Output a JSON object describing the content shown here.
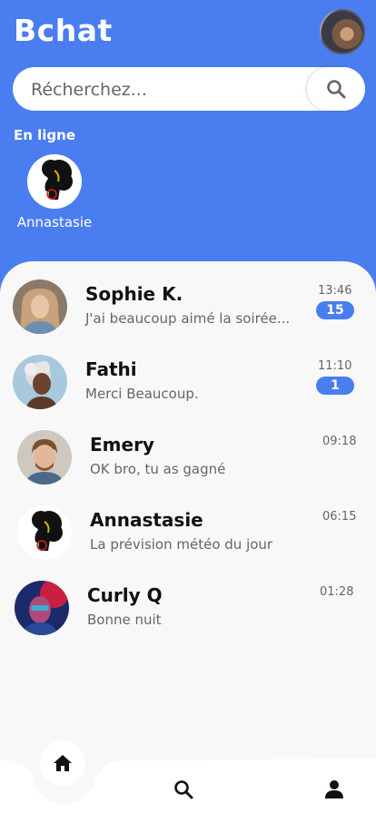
{
  "header": {
    "title": "Bchat"
  },
  "search": {
    "placeholder": "Récherchez..."
  },
  "online": {
    "title": "En ligne",
    "users": [
      {
        "name": "Annastasie"
      }
    ]
  },
  "chats": [
    {
      "name": "Sophie K.",
      "message": "J'ai beaucoup aimé la soirée...",
      "time": "13:46",
      "unread": "15"
    },
    {
      "name": "Fathi",
      "message": "Merci Beaucoup.",
      "time": "11:10",
      "unread": "1"
    },
    {
      "name": "Emery",
      "message": "OK bro, tu as gagné",
      "time": "09:18",
      "unread": ""
    },
    {
      "name": "Annastasie",
      "message": "La prévision météo du jour",
      "time": "06:15",
      "unread": ""
    },
    {
      "name": "Curly Q",
      "message": "Bonne nuit",
      "time": "01:28",
      "unread": ""
    }
  ],
  "nav": {
    "items": [
      {
        "icon": "home-icon",
        "active": true
      },
      {
        "icon": "search-icon",
        "active": false
      },
      {
        "icon": "user-icon",
        "active": false
      }
    ]
  },
  "colors": {
    "primary": "#4a7df0",
    "background": "#f8f8f8"
  }
}
